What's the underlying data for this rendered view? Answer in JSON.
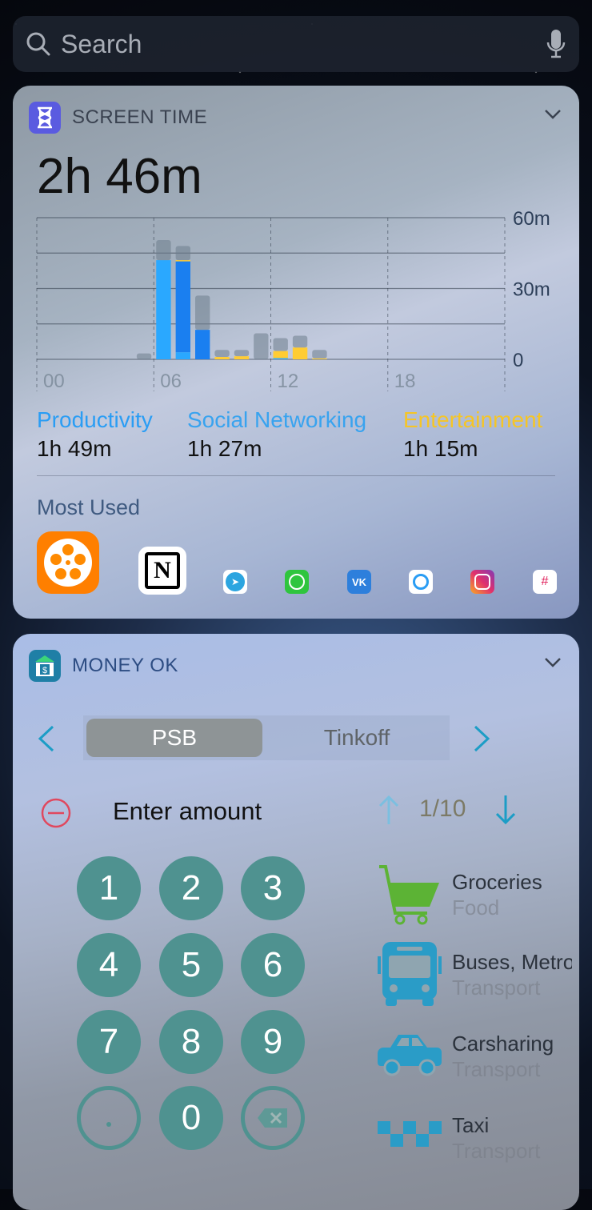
{
  "search": {
    "placeholder": "Search"
  },
  "screen_time": {
    "title": "SCREEN TIME",
    "total": "2h 46m",
    "categories": [
      {
        "name": "Productivity",
        "value": "1h 49m",
        "color": "#2a9df4"
      },
      {
        "name": "Social Networking",
        "value": "1h 27m",
        "color": "#38a3ef"
      },
      {
        "name": "Entertainment",
        "value": "1h 15m",
        "color": "#f5c526"
      }
    ],
    "most_used_label": "Most Used",
    "apps": [
      "Kinopoisk",
      "Notion",
      "Telegram",
      "WhatsApp",
      "VK",
      "Ring",
      "Instagram",
      "Slack"
    ]
  },
  "chart_data": {
    "type": "bar",
    "stacked": true,
    "x_ticks": [
      "00",
      "06",
      "12",
      "18"
    ],
    "y_ticks": [
      "0",
      "30m",
      "60m"
    ],
    "ylim": [
      0,
      60
    ],
    "hours": [
      5,
      6,
      7,
      8,
      9,
      10,
      11,
      12,
      13,
      14
    ],
    "series": [
      {
        "key": "productivity",
        "color": "#2aa8ff",
        "values": [
          0,
          42,
          3,
          0,
          0,
          0,
          0,
          0.5,
          0,
          0
        ]
      },
      {
        "key": "social",
        "color": "#1a7ff0",
        "values": [
          0,
          0,
          38.5,
          12.5,
          0,
          0,
          0,
          0,
          0,
          0
        ]
      },
      {
        "key": "entertainment",
        "color": "#ffcc33",
        "values": [
          0,
          0,
          0.5,
          0,
          1,
          1.3,
          0,
          3,
          5,
          0.4
        ]
      },
      {
        "key": "other",
        "color": "rgba(110,125,140,.55)",
        "values": [
          2.5,
          8.5,
          6,
          14.5,
          3,
          2.7,
          11,
          5.5,
          5,
          3.6
        ]
      }
    ]
  },
  "money": {
    "title": "MONEY OK",
    "banks": [
      "PSB",
      "Tinkoff"
    ],
    "selected_bank": "PSB",
    "amount_placeholder": "Enter amount",
    "page": "1/10",
    "keys": [
      "1",
      "2",
      "3",
      "4",
      "5",
      "6",
      "7",
      "8",
      "9",
      ".",
      "0",
      "⌫"
    ],
    "items": [
      {
        "name": "Groceries",
        "group": "Food",
        "icon": "cart-icon",
        "color": "#5cb335"
      },
      {
        "name": "Buses, Metro",
        "group": "Transport",
        "icon": "bus-icon",
        "color": "#2a9cc7"
      },
      {
        "name": "Carsharing",
        "group": "Transport",
        "icon": "car-icon",
        "color": "#2a9cc7"
      },
      {
        "name": "Taxi",
        "group": "Transport",
        "icon": "taxi-icon",
        "color": "#2a9cc7"
      }
    ]
  }
}
